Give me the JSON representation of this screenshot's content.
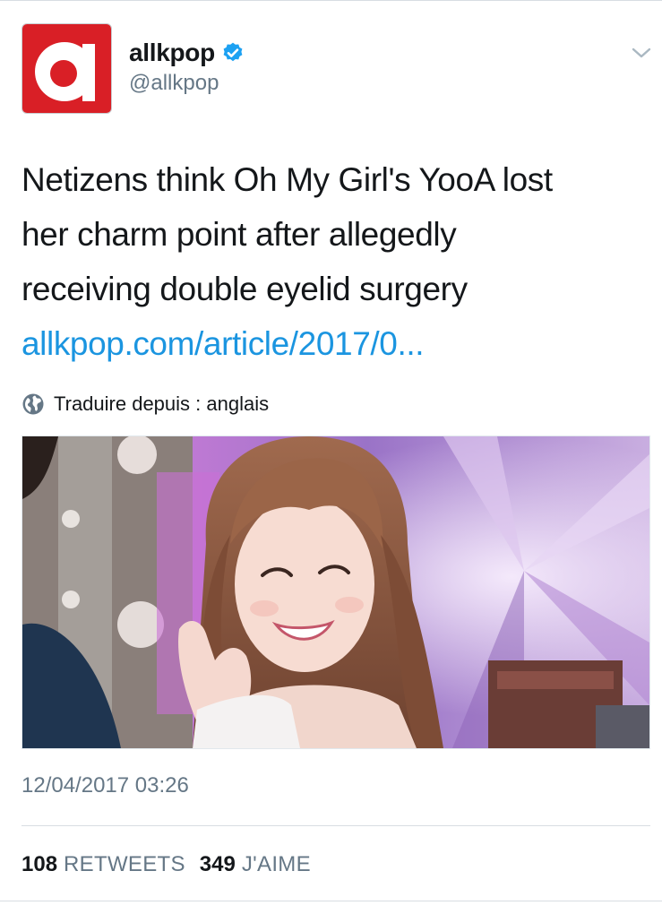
{
  "author": {
    "display_name": "allkpop",
    "handle": "@allkpop",
    "avatar_letter": "a",
    "verified": true,
    "brand_color": "#d91f26",
    "verified_color": "#1da1f2"
  },
  "tweet": {
    "text_lines": [
      "Netizens think Oh My Girl's YooA lost",
      "her charm point after allegedly",
      "receiving double eyelid surgery"
    ],
    "link_text": "allkpop.com/article/2017/0...",
    "link_color": "#1b95e0"
  },
  "translate": {
    "label": "Traduire depuis : anglais",
    "icon": "globe-icon"
  },
  "media": {
    "type": "photo"
  },
  "timestamp": "12/04/2017 03:26",
  "stats": {
    "retweets": {
      "count": "108",
      "label": "RETWEETS"
    },
    "likes": {
      "count": "349",
      "label": "J'AIME"
    }
  },
  "icons": {
    "menu": "chevron-down-icon",
    "verified": "verified-badge-icon"
  }
}
